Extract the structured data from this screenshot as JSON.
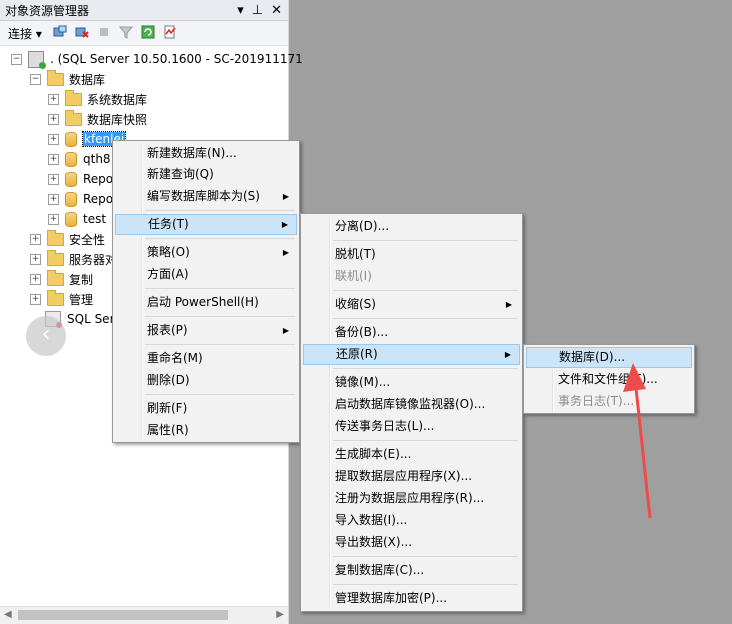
{
  "window": {
    "title": "对象资源管理器",
    "pin_glyph": "▼ ⊥",
    "close_glyph": "✕"
  },
  "toolbar": {
    "connect_label": "连接 ▾"
  },
  "tree": {
    "server": ". (SQL Server 10.50.1600 - SC-201911171",
    "databases": "数据库",
    "system_dbs": "系统数据库",
    "snapshots": "数据库快照",
    "db1": "kfenlei",
    "db2": "qth8",
    "db3": "Repo",
    "db4": "Repo",
    "db5": "test",
    "security": "安全性",
    "server_objects": "服务器对",
    "replication": "复制",
    "management": "管理",
    "agent": "SQL Serv"
  },
  "menu1": {
    "new_db": "新建数据库(N)...",
    "new_query": "新建查询(Q)",
    "script_db": "编写数据库脚本为(S)",
    "tasks": "任务(T)",
    "policies": "策略(O)",
    "facets": "方面(A)",
    "powershell": "启动 PowerShell(H)",
    "reports": "报表(P)",
    "rename": "重命名(M)",
    "delete": "删除(D)",
    "refresh": "刷新(F)",
    "properties": "属性(R)"
  },
  "menu2": {
    "detach": "分离(D)...",
    "offline": "脱机(T)",
    "online": "联机(I)",
    "shrink": "收缩(S)",
    "backup": "备份(B)...",
    "restore": "还原(R)",
    "mirror": "镜像(M)...",
    "mirror_monitor": "启动数据库镜像监视器(O)...",
    "log_ship": "传送事务日志(L)...",
    "gen_scripts": "生成脚本(E)...",
    "extract_dac": "提取数据层应用程序(X)...",
    "register_dac": "注册为数据层应用程序(R)...",
    "import": "导入数据(I)...",
    "export": "导出数据(X)...",
    "copy_db": "复制数据库(C)...",
    "manage_enc": "管理数据库加密(P)..."
  },
  "menu3": {
    "database": "数据库(D)...",
    "files": "文件和文件组(F)...",
    "tlog": "事务日志(T)..."
  },
  "colors": {
    "selection": "#3399ff",
    "highlight": "#cce4f7",
    "arrow": "#ee4b4b"
  }
}
